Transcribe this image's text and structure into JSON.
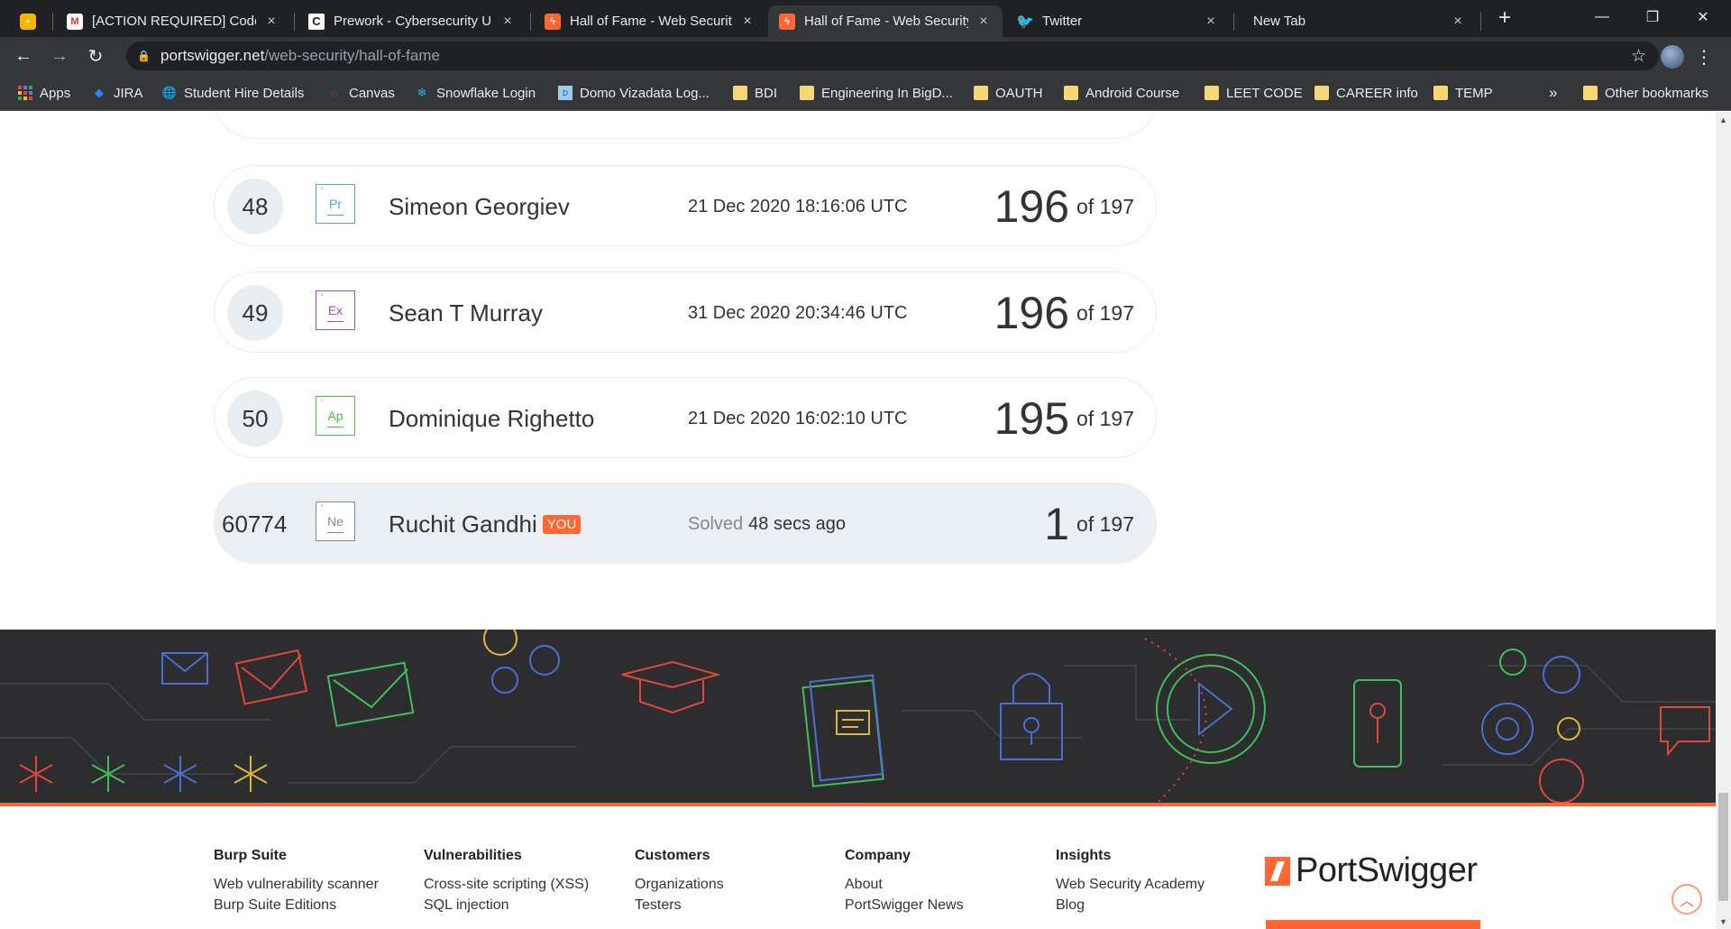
{
  "tabs": [
    {
      "title": "",
      "icon": "sticky-note-icon",
      "close": ""
    },
    {
      "title": "[ACTION REQUIRED] CodeP",
      "icon": "gmail-icon",
      "close": "×"
    },
    {
      "title": "Prework - Cybersecurity Un",
      "icon": "c-icon",
      "close": "×"
    },
    {
      "title": "Hall of Fame - Web Security",
      "icon": "portswigger-icon",
      "close": "×"
    },
    {
      "title": "Hall of Fame - Web Security",
      "icon": "portswigger-icon",
      "close": "×"
    },
    {
      "title": "Twitter",
      "icon": "twitter-icon",
      "close": "×"
    },
    {
      "title": "New Tab",
      "icon": "",
      "close": "×"
    }
  ],
  "window_controls": {
    "minimize": "—",
    "restore": "❐",
    "close": "✕"
  },
  "new_tab": "+",
  "address": {
    "host": "portswigger.net",
    "path": "/web-security/hall-of-fame"
  },
  "bookmarks": [
    {
      "label": "Apps"
    },
    {
      "label": "JIRA"
    },
    {
      "label": "Student Hire Details"
    },
    {
      "label": "Canvas"
    },
    {
      "label": "Snowflake Login"
    },
    {
      "label": "Domo Vizadata Log..."
    },
    {
      "label": "BDI"
    },
    {
      "label": "Engineering In BigD..."
    },
    {
      "label": "OAUTH"
    },
    {
      "label": "Android Course"
    },
    {
      "label": "LEET CODE"
    },
    {
      "label": "CAREER info"
    },
    {
      "label": "TEMP"
    }
  ],
  "bookmarks_overflow": "»",
  "other_bookmarks": "Other bookmarks",
  "leaderboard": [
    {
      "rank": "48",
      "badge": "Pr",
      "badge_color": "#4aa8e0",
      "name": "Simeon Georgiev",
      "date": "21 Dec 2020 18:16:06 UTC",
      "score": "196",
      "of": "of 197"
    },
    {
      "rank": "49",
      "badge": "Ex",
      "badge_color": "#9b4fc4",
      "name": "Sean T Murray",
      "date": "31 Dec 2020 20:34:46 UTC",
      "score": "196",
      "of": "of 197"
    },
    {
      "rank": "50",
      "badge": "Ap",
      "badge_color": "#4cbf4c",
      "name": "Dominique Righetto",
      "date": "21 Dec 2020 16:02:10 UTC",
      "score": "195",
      "of": "of 197"
    }
  ],
  "you_row": {
    "rank": "60774",
    "badge": "Ne",
    "badge_color": "#888888",
    "name": "Ruchit Gandhi",
    "you_label": "YOU",
    "solved_label": "Solved",
    "solved_time": "48 secs ago",
    "score": "1",
    "of": "of 197"
  },
  "footer": {
    "columns": [
      {
        "heading": "Burp Suite",
        "links": [
          "Web vulnerability scanner",
          "Burp Suite Editions"
        ]
      },
      {
        "heading": "Vulnerabilities",
        "links": [
          "Cross-site scripting (XSS)",
          "SQL injection"
        ]
      },
      {
        "heading": "Customers",
        "links": [
          "Organizations",
          "Testers"
        ]
      },
      {
        "heading": "Company",
        "links": [
          "About",
          "PortSwigger News"
        ]
      },
      {
        "heading": "Insights",
        "links": [
          "Web Security Academy",
          "Blog"
        ]
      }
    ],
    "logo": "PortSwigger"
  },
  "colors": {
    "accent": "#ff6633",
    "band": "#2d2d2f"
  }
}
